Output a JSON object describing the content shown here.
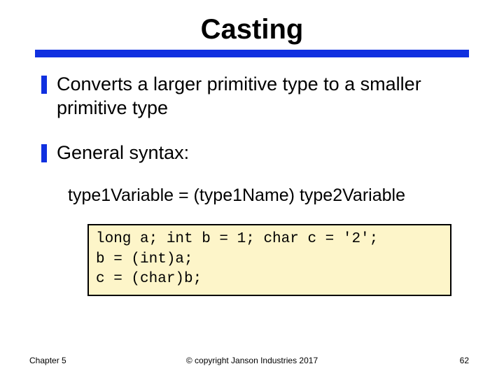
{
  "title": "Casting",
  "bullets": [
    {
      "text": "Converts a larger primitive type to a smaller primitive type"
    },
    {
      "text": "General syntax:"
    }
  ],
  "syntax_line": "type1Variable = (type1Name) type2Variable",
  "code": {
    "l1": "long a; int b = 1; char c = '2';",
    "l2": "b = (int)a;",
    "l3": "c = (char)b;"
  },
  "footer": {
    "chapter": "Chapter 5",
    "copyright": "© copyright Janson Industries 2017",
    "page": "62"
  }
}
